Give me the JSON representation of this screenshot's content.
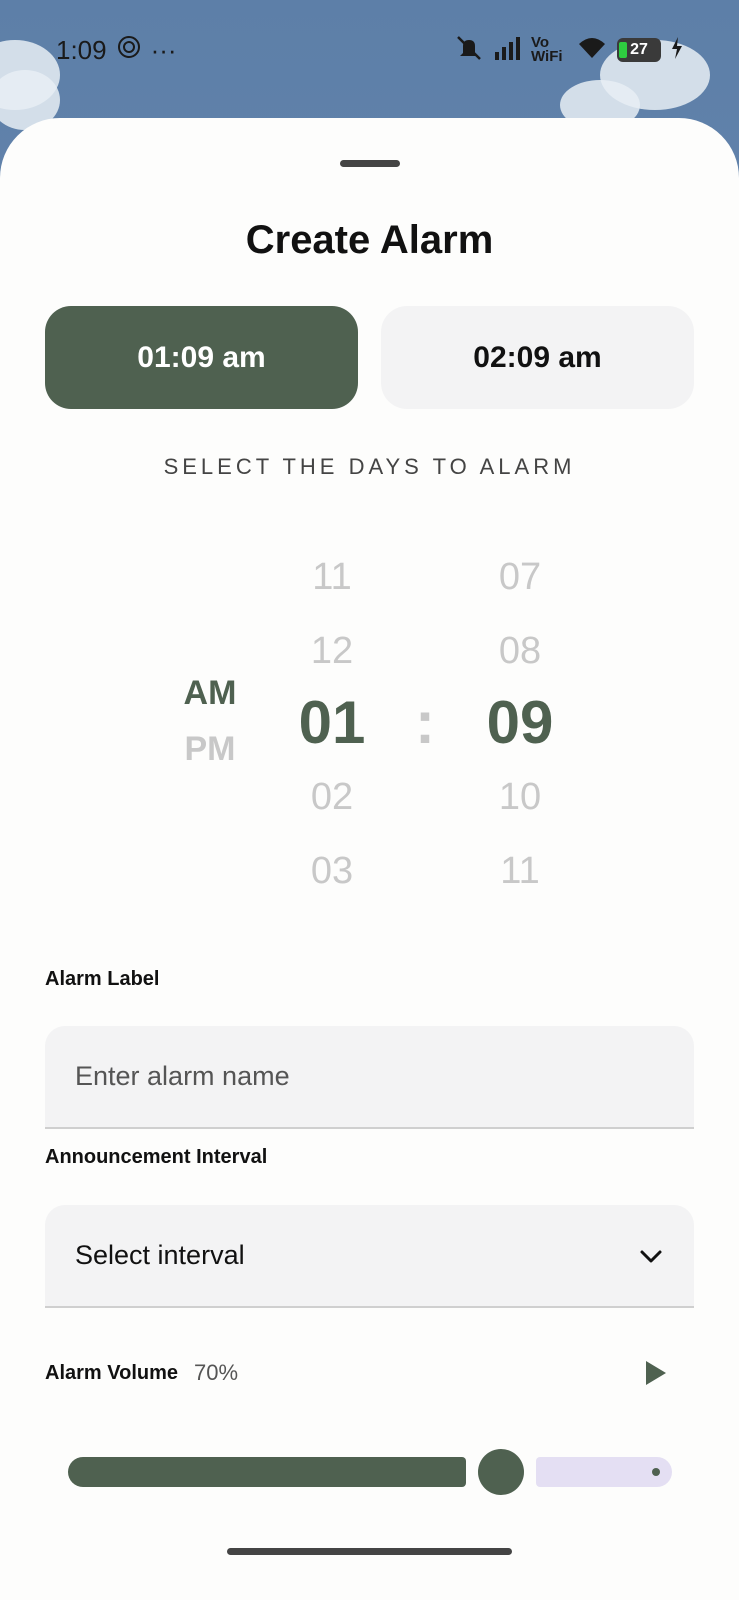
{
  "status_bar": {
    "time": "1:09",
    "battery": "27",
    "network_label": "Vo WiFi"
  },
  "sheet": {
    "title": "Create Alarm",
    "start_time": "01:09 am",
    "end_time": "02:09 am",
    "days_label": "SELECT THE DAYS TO ALARM"
  },
  "picker": {
    "am": "AM",
    "pm": "PM",
    "hours": [
      "11",
      "12",
      "01",
      "02",
      "03"
    ],
    "minutes": [
      "07",
      "08",
      "09",
      "10",
      "11"
    ],
    "separator": ":"
  },
  "form": {
    "label_title": "Alarm Label",
    "label_placeholder": "Enter alarm name",
    "interval_title": "Announcement Interval",
    "interval_value": "Select interval",
    "volume_title": "Alarm Volume",
    "volume_value": "70%",
    "volume_level": 0.7
  },
  "colors": {
    "accent": "#4f6150",
    "inactive_track": "#e4dff3"
  }
}
